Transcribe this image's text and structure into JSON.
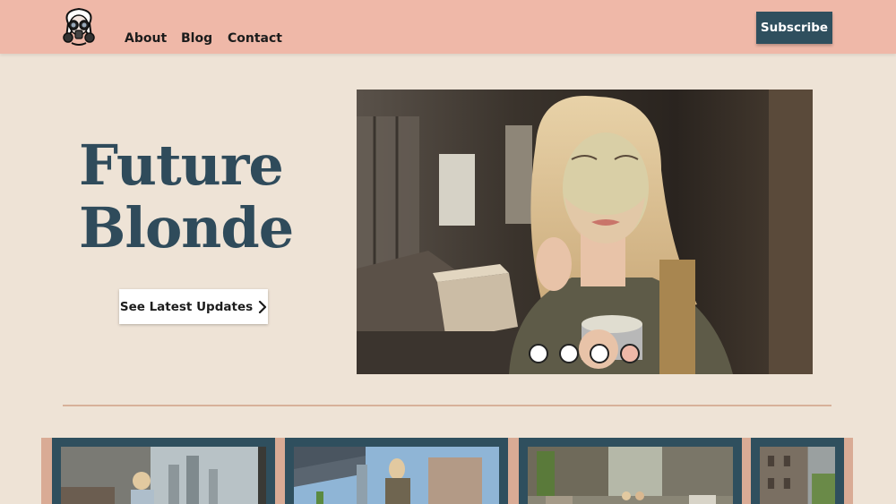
{
  "header": {
    "logo_icon": "gas-mask-girl-logo",
    "nav": [
      "About",
      "Blog",
      "Contact"
    ],
    "subscribe_label": "Subscribe"
  },
  "hero": {
    "title_line1": "Future",
    "title_line2": "Blonde",
    "cta_label": "See Latest Updates",
    "cta_icon": "chevron-right-icon",
    "slider_dots": 4,
    "active_dot": 4
  },
  "colors": {
    "header_bg": "#efb8a8",
    "page_bg": "#eee3d6",
    "accent_dark": "#2f4f5e",
    "divider": "#d7b19a"
  }
}
